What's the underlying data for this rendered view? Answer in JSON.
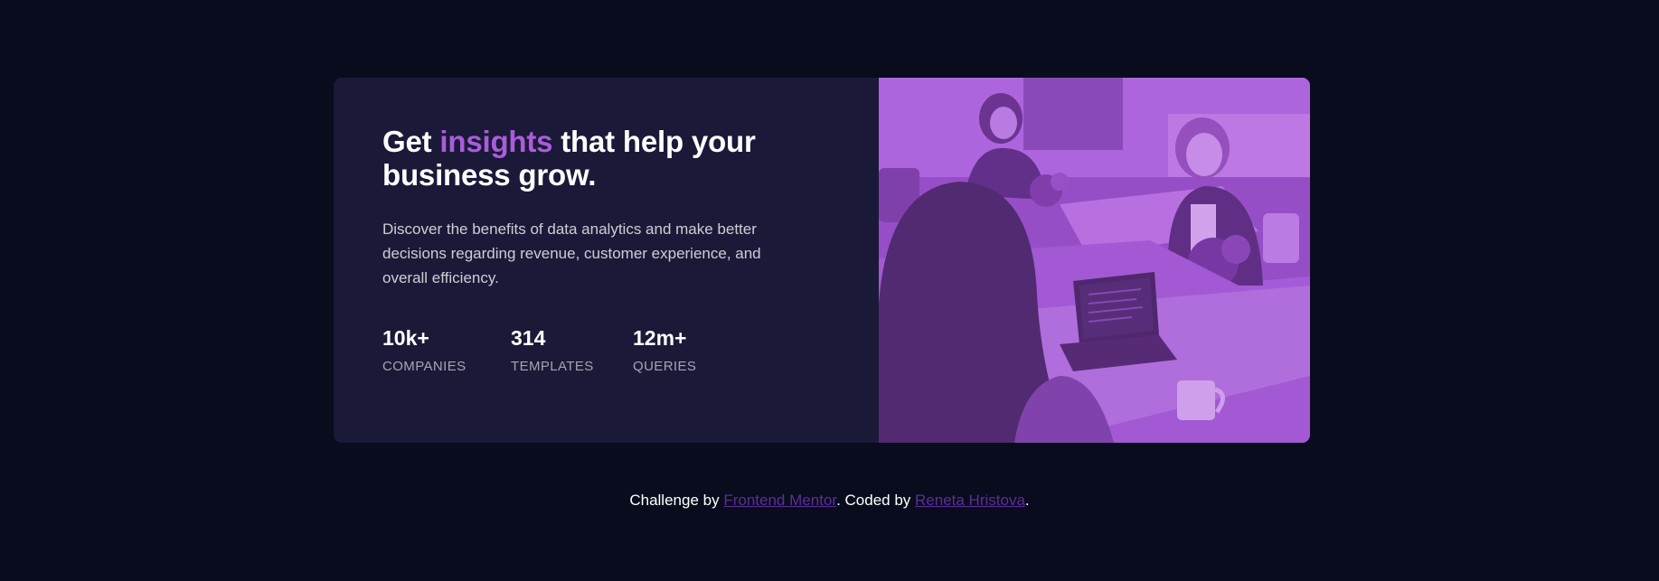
{
  "card": {
    "headline": {
      "before": "Get ",
      "accent": "insights",
      "after": " that help your business grow."
    },
    "description": "Discover the benefits of data analytics and make better decisions regarding revenue, customer experience, and overall efficiency.",
    "stats": [
      {
        "value": "10k+",
        "label": "COMPANIES"
      },
      {
        "value": "314",
        "label": "TEMPLATES"
      },
      {
        "value": "12m+",
        "label": "QUERIES"
      }
    ],
    "image_overlay_color": "#aa5cdb"
  },
  "attribution": {
    "prefix": "Challenge by ",
    "link1": "Frontend Mentor",
    "middle": ". Coded by ",
    "link2": "Reneta Hristova",
    "suffix": "."
  },
  "colors": {
    "page_background": "#080c1d",
    "card_background": "#1b1938",
    "accent": "#aa5cdb",
    "link": "#5d2d9a"
  }
}
